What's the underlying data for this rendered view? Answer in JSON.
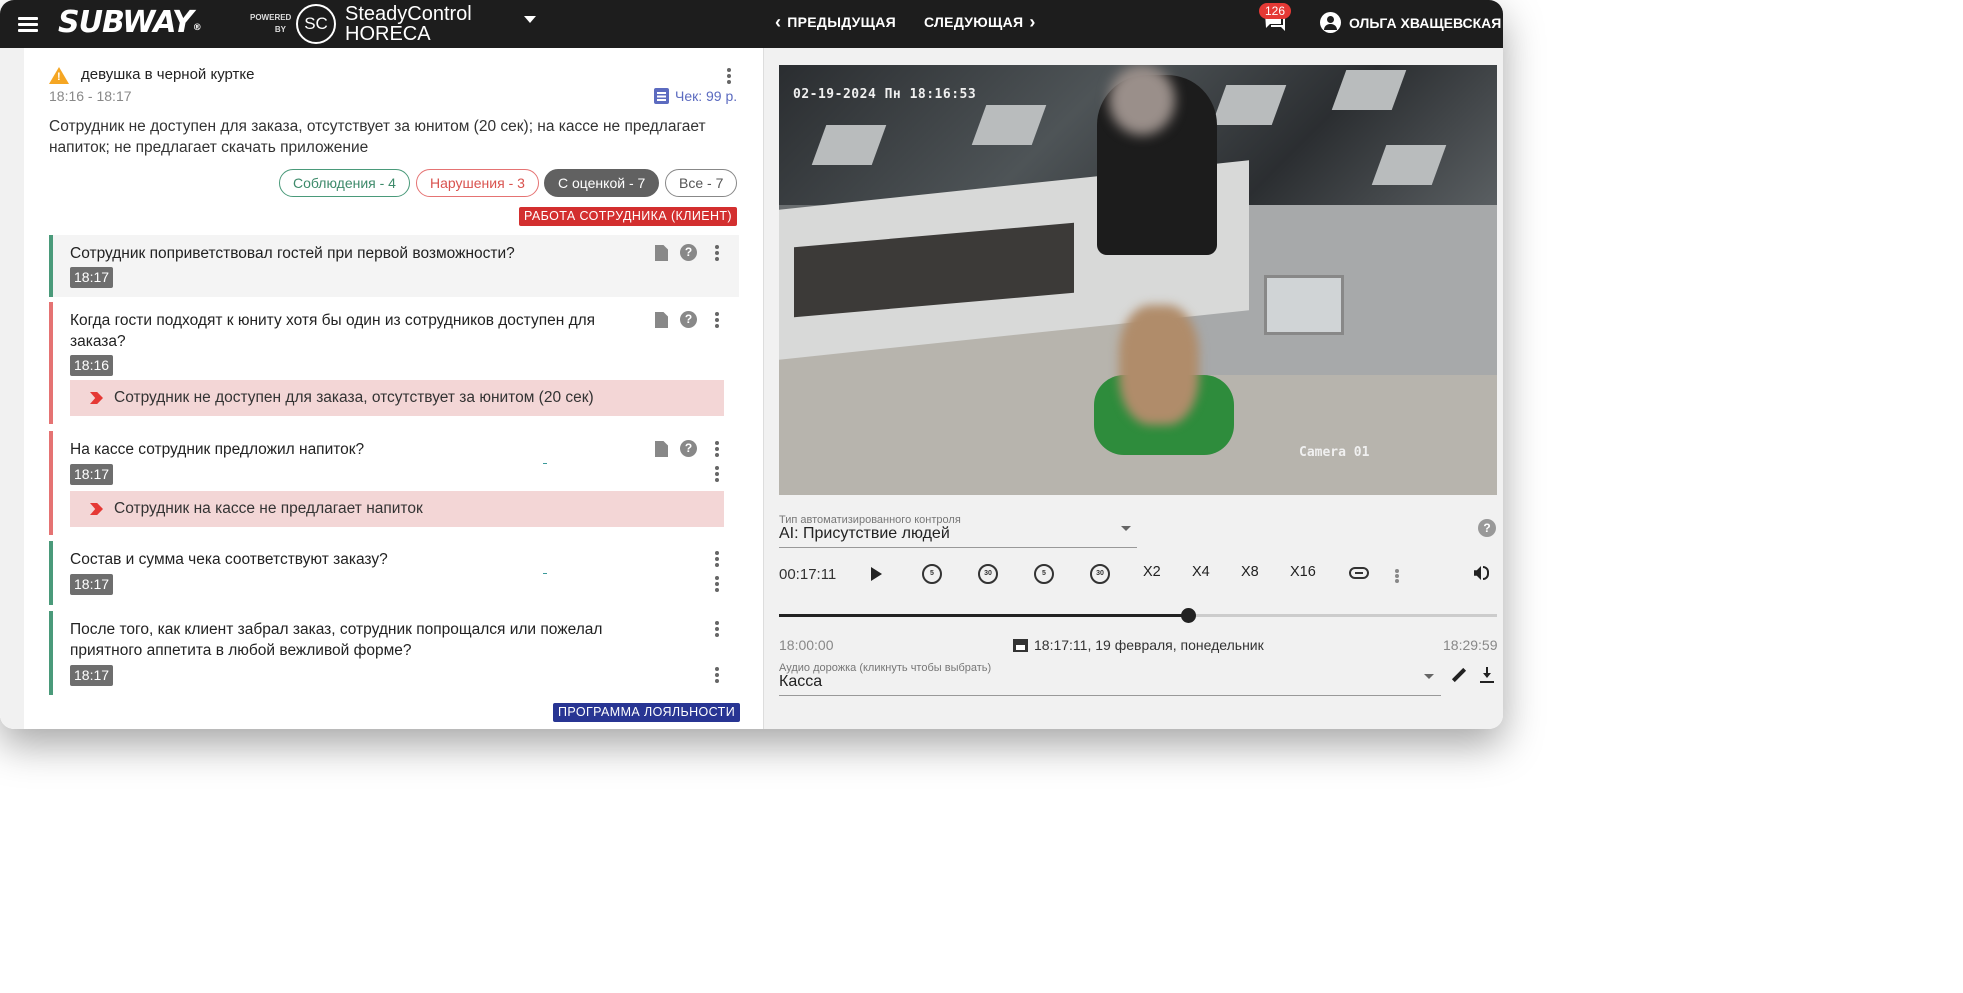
{
  "header": {
    "logo_text": "SUBWAY",
    "logo_reg": "®",
    "powered_by": "POWERED BY",
    "sc_initials": "SC",
    "brand_line1": "SteadyControl",
    "brand_line2": "HORECA",
    "prev_label": "ПРЕДЫДУЩАЯ",
    "next_label": "СЛЕДУЮЩАЯ",
    "notifications_count": "126",
    "user_name": "ОЛЬГА ХВАЩЕВСКАЯ"
  },
  "incident": {
    "title": "девушка в черной куртке",
    "time_range": "18:16 - 18:17",
    "receipt": "Чек: 99 р.",
    "description": "Сотрудник не доступен для заказа, отсутствует за юнитом (20 сек); на кассе не предлагает напиток; не предлагает скачать приложение"
  },
  "filters": [
    {
      "label": "Соблюдения - 4"
    },
    {
      "label": "Нарушения - 3"
    },
    {
      "label": "С оценкой - 7"
    },
    {
      "label": "Все - 7"
    }
  ],
  "sections": {
    "employee_work": "РАБОТА СОТРУДНИКА (КЛИЕНТ)",
    "loyalty": "ПРОГРАММА ЛОЯЛЬНОСТИ"
  },
  "questions": [
    {
      "text": "Сотрудник поприветствовал гостей при первой возможности?",
      "time": "18:17"
    },
    {
      "text": "Когда гости подходят к юниту хотя бы один из сотрудников доступен для заказа?",
      "time": "18:16",
      "violation": "Сотрудник не доступен для заказа, отсутствует за юнитом (20 сек)"
    },
    {
      "text": "На кассе сотрудник предложил напиток?",
      "time": "18:17",
      "violation": "Сотрудник на кассе не предлагает напиток"
    },
    {
      "text": "Состав и сумма чека соответствуют заказу?",
      "time": "18:17"
    },
    {
      "text": "После того, как клиент забрал заказ, сотрудник попрощался или пожелал приятного аппетита в любой вежливой форме?",
      "time": "18:17"
    }
  ],
  "video": {
    "timestamp": "02-19-2024 Пн 18:16:53",
    "camera": "Camera 01"
  },
  "control_type": {
    "label": "Тип автоматизированного контроля",
    "value": "AI: Присутствие людей"
  },
  "player": {
    "current_time": "00:17:11",
    "rewind_5": "5",
    "rewind_30": "30",
    "forward_5": "5",
    "forward_30": "30",
    "speeds": [
      "X2",
      "X4",
      "X8",
      "X16"
    ],
    "progress": 0.57,
    "start": "18:00:00",
    "end": "18:29:59",
    "current_datetime": "18:17:11, 19 февраля, понедельник"
  },
  "audio": {
    "label": "Аудио дорожка (кликнуть чтобы выбрать)",
    "value": "Касса"
  }
}
